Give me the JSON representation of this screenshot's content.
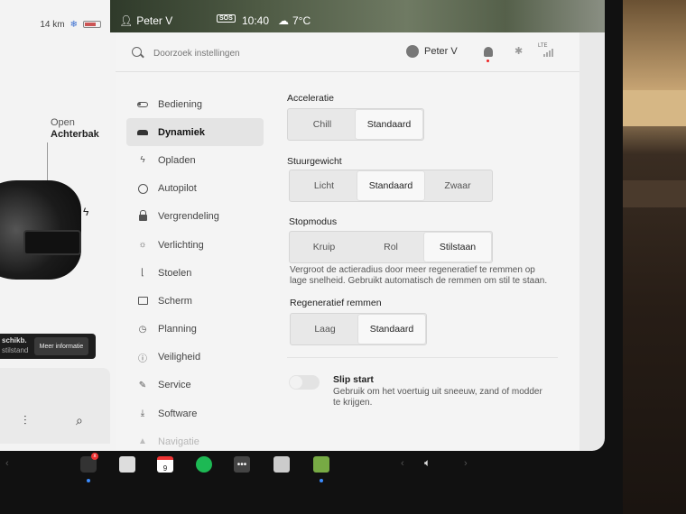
{
  "car_panel": {
    "range": "14 km",
    "trunk_state": "Open",
    "trunk_label": "Achterbak",
    "notice_line1": "schikb.",
    "notice_line2": "stilstand",
    "notice_button": "Meer informatie"
  },
  "status_bar": {
    "user": "Peter V",
    "sos": "SOS",
    "time": "10:40",
    "temperature": "7°C"
  },
  "header": {
    "search_placeholder": "Doorzoek instellingen",
    "user_name": "Peter V",
    "network": "LTE"
  },
  "menu": {
    "items": [
      {
        "label": "Bediening",
        "icon": "toggle-icon"
      },
      {
        "label": "Dynamiek",
        "icon": "car-icon",
        "active": true
      },
      {
        "label": "Opladen",
        "icon": "bolt-icon"
      },
      {
        "label": "Autopilot",
        "icon": "steering-wheel-icon"
      },
      {
        "label": "Vergrendeling",
        "icon": "lock-icon"
      },
      {
        "label": "Verlichting",
        "icon": "sun-icon"
      },
      {
        "label": "Stoelen",
        "icon": "seat-icon"
      },
      {
        "label": "Scherm",
        "icon": "display-icon"
      },
      {
        "label": "Planning",
        "icon": "clock-icon"
      },
      {
        "label": "Veiligheid",
        "icon": "info-icon"
      },
      {
        "label": "Service",
        "icon": "wrench-icon"
      },
      {
        "label": "Software",
        "icon": "download-icon"
      },
      {
        "label": "Navigatie",
        "icon": "navigation-icon"
      }
    ]
  },
  "settings": {
    "acceleration": {
      "label": "Acceleratie",
      "options": [
        "Chill",
        "Standaard"
      ],
      "selected": "Standaard"
    },
    "steering": {
      "label": "Stuurgewicht",
      "options": [
        "Licht",
        "Standaard",
        "Zwaar"
      ],
      "selected": "Standaard"
    },
    "stop_mode": {
      "label": "Stopmodus",
      "options": [
        "Kruip",
        "Rol",
        "Stilstaan"
      ],
      "selected": "Stilstaan",
      "description_line1": "Vergroot de actieradius door meer regeneratief te remmen op",
      "description_line2": "lage snelheid. Gebruikt automatisch de remmen om stil te staan."
    },
    "regen": {
      "label": "Regeneratief remmen",
      "options": [
        "Laag",
        "Standaard"
      ],
      "selected": "Standaard"
    },
    "slip_start": {
      "label": "Slip start",
      "enabled": false,
      "description_line1": "Gebruik om het voertuig uit sneeuw, zand of modder",
      "description_line2": "te krijgen."
    }
  },
  "dock": {
    "calendar_day": "9",
    "notification_badge": "x"
  },
  "colors": {
    "screen_bg": "#f4f4f4",
    "selected_option": "#f8f8f8",
    "active_menu": "#e4e4e4",
    "dock_dot": "#3b8cff"
  }
}
